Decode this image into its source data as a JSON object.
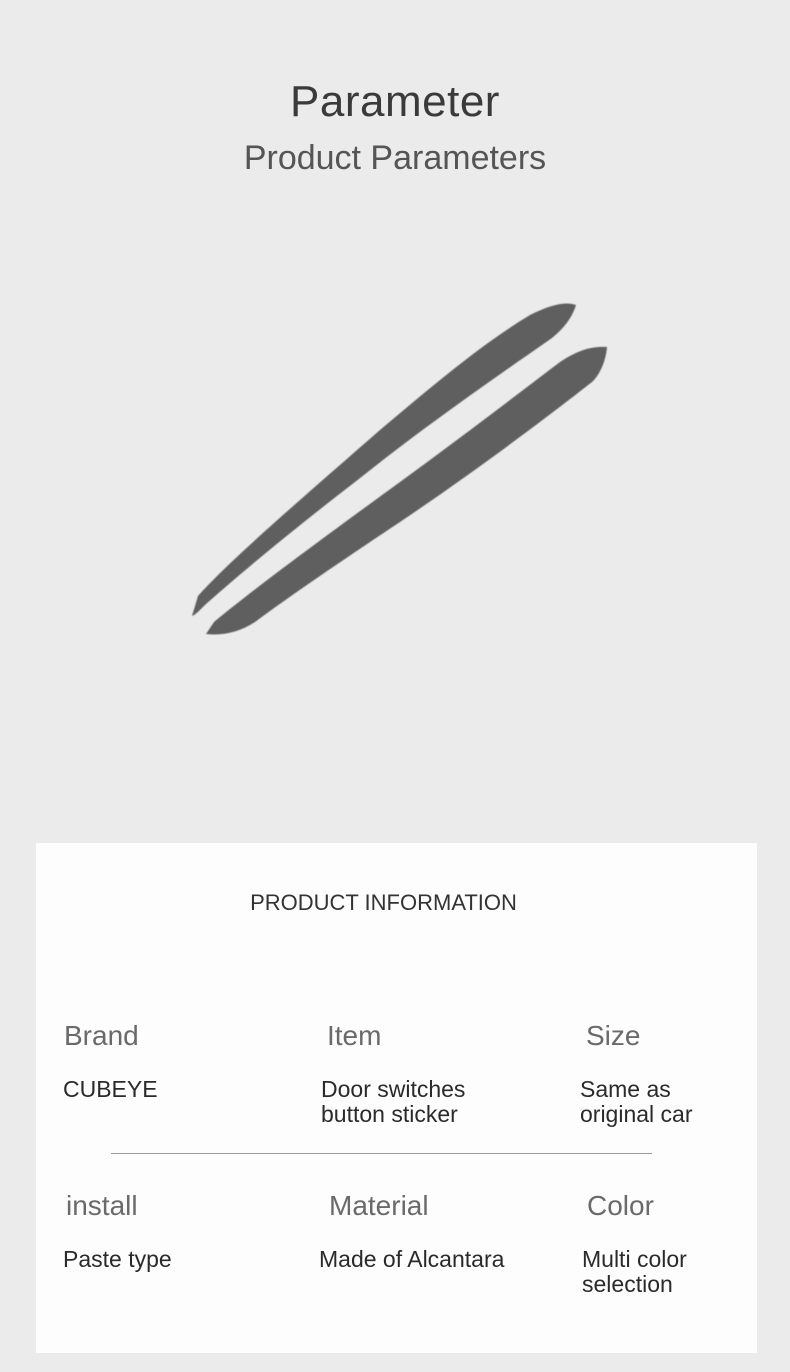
{
  "header": {
    "title": "Parameter",
    "subtitle": "Product Parameters"
  },
  "product_image": {
    "description_icon": "door-trim-strips",
    "color": "#5e5e5e"
  },
  "info": {
    "title": "PRODUCT INFORMATION",
    "rows": [
      {
        "cells": [
          {
            "label": "Brand",
            "value_lines": [
              "CUBEYE"
            ]
          },
          {
            "label": "Item",
            "value_lines": [
              "Door switches",
              "button sticker"
            ]
          },
          {
            "label": "Size",
            "value_lines": [
              "Same as",
              "original car"
            ]
          }
        ]
      },
      {
        "cells": [
          {
            "label": "install",
            "value_lines": [
              "Paste type"
            ]
          },
          {
            "label": "Material",
            "value_lines": [
              "Made of Alcantara"
            ]
          },
          {
            "label": "Color",
            "value_lines": [
              "Multi color",
              "selection"
            ]
          }
        ]
      }
    ]
  }
}
